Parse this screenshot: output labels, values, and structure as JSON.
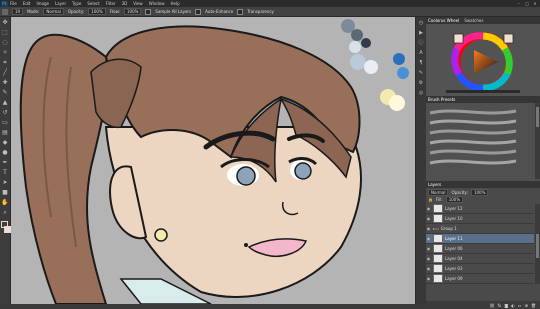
{
  "menubar": {
    "logo": "Ps",
    "items": [
      "File",
      "Edit",
      "Image",
      "Layer",
      "Type",
      "Select",
      "Filter",
      "3D",
      "View",
      "Window",
      "Help"
    ]
  },
  "options_bar": {
    "size_value": "19",
    "mode_label": "Mode:",
    "mode_value": "Normal",
    "opacity_label": "Opacity:",
    "opacity_value": "100%",
    "flow_label": "Flow:",
    "flow_value": "100%",
    "sample_all_label": "Sample All Layers",
    "auto_enhance_label": "Auto-Enhance",
    "transparency_label": "Transparency"
  },
  "panels": {
    "color_tabs": [
      "Coolorus Wheel",
      "Swatches"
    ],
    "brush_tabs": [
      "Brush Presets"
    ],
    "layers_tabs": [
      "Layers"
    ],
    "blend_mode": "Normal",
    "opacity_label": "Opacity:",
    "opacity_value": "100%",
    "fill_label": "Fill:",
    "fill_value": "100%",
    "layers": [
      {
        "name": "Layer 12",
        "selected": false
      },
      {
        "name": "Layer 10",
        "selected": false
      },
      {
        "name": "Group 1",
        "selected": false
      },
      {
        "name": "Layer 11",
        "selected": true
      },
      {
        "name": "Layer 06",
        "selected": false
      },
      {
        "name": "Layer 04",
        "selected": false
      },
      {
        "name": "Layer 03",
        "selected": false
      },
      {
        "name": "Layer 09",
        "selected": false
      }
    ]
  },
  "colors": {
    "canvas_bg": "#b4b4b4",
    "skin": "#ecd5c1",
    "hair": "#98705a",
    "hair_dark": "#7a5847",
    "lip": "#f3b6cb",
    "iris": "#8fa3b8",
    "earring": "#f4eaae",
    "swatch_fg": "#4a3a30",
    "swatch_bg": "#f2ddd0"
  },
  "icons": {
    "toolbar": [
      "move-icon",
      "marquee-icon",
      "lasso-icon",
      "magic-wand-icon",
      "crop-icon",
      "eyedropper-icon",
      "healing-icon",
      "brush-icon",
      "stamp-icon",
      "history-brush-icon",
      "eraser-icon",
      "gradient-icon",
      "blur-icon",
      "dodge-icon",
      "pen-icon",
      "type-icon",
      "path-select-icon",
      "shape-icon",
      "hand-icon",
      "zoom-icon"
    ],
    "panel_strip": [
      "history-icon",
      "actions-icon",
      "info-icon",
      "character-icon",
      "paragraph-icon",
      "brush-panel-icon",
      "tool-presets-icon",
      "clone-source-icon"
    ]
  }
}
